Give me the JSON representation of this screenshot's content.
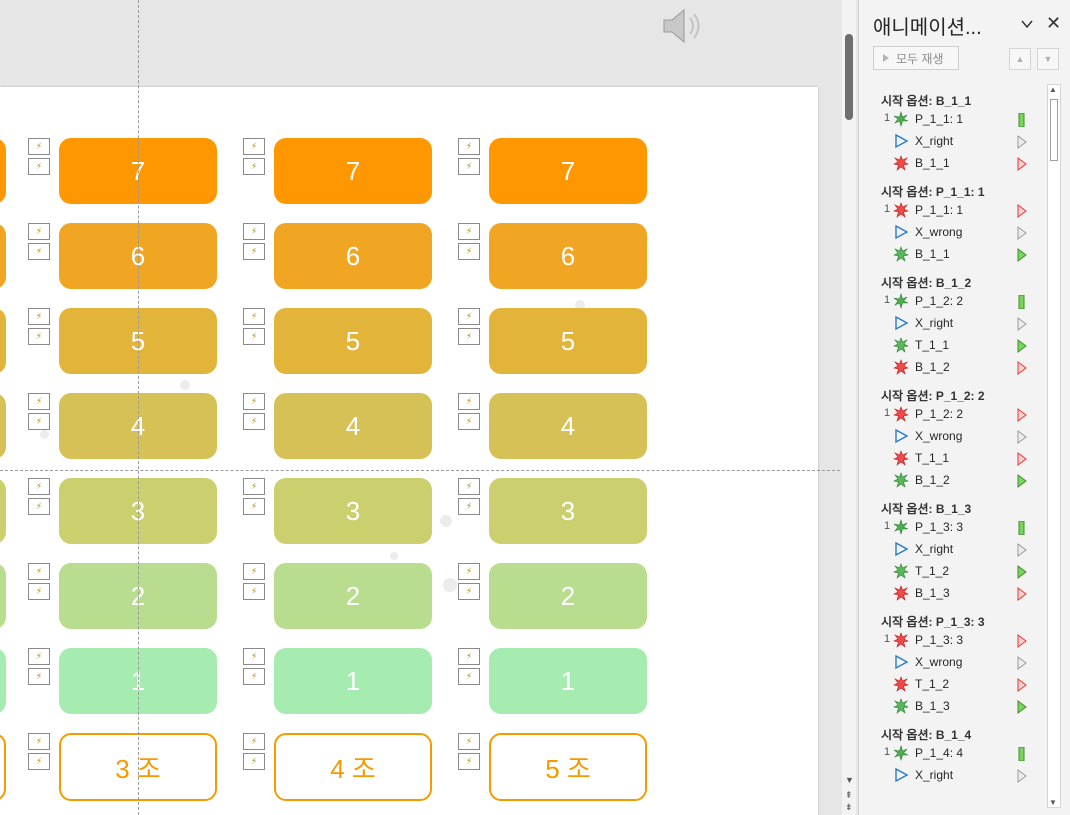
{
  "pane": {
    "title": "애니메이션...",
    "play_all_label": "모두 재생",
    "groups": [
      {
        "heading": "시작 옵션: B_1_1",
        "items": [
          {
            "num": "1",
            "label": "P_1_1: 1",
            "icon": "green-spark-icon",
            "timeline": "green-bar"
          },
          {
            "num": "",
            "label": "X_right",
            "icon": "play-triangle-icon",
            "timeline": "gray-triangle"
          },
          {
            "num": "",
            "label": "B_1_1",
            "icon": "red-burst-icon",
            "timeline": "red-triangle"
          }
        ]
      },
      {
        "heading": "시작 옵션: P_1_1: 1",
        "items": [
          {
            "num": "1",
            "label": "P_1_1: 1",
            "icon": "red-burst-icon",
            "timeline": "red-triangle"
          },
          {
            "num": "",
            "label": "X_wrong",
            "icon": "play-triangle-icon",
            "timeline": "gray-triangle"
          },
          {
            "num": "",
            "label": "B_1_1",
            "icon": "green-burst-icon",
            "timeline": "green-triangle"
          }
        ]
      },
      {
        "heading": "시작 옵션: B_1_2",
        "items": [
          {
            "num": "1",
            "label": "P_1_2: 2",
            "icon": "green-spark-icon",
            "timeline": "green-bar"
          },
          {
            "num": "",
            "label": "X_right",
            "icon": "play-triangle-icon",
            "timeline": "gray-triangle"
          },
          {
            "num": "",
            "label": "T_1_1",
            "icon": "green-burst-icon",
            "timeline": "green-triangle"
          },
          {
            "num": "",
            "label": "B_1_2",
            "icon": "red-burst-icon",
            "timeline": "red-triangle"
          }
        ]
      },
      {
        "heading": "시작 옵션: P_1_2: 2",
        "items": [
          {
            "num": "1",
            "label": "P_1_2: 2",
            "icon": "red-burst-icon",
            "timeline": "red-triangle"
          },
          {
            "num": "",
            "label": "X_wrong",
            "icon": "play-triangle-icon",
            "timeline": "gray-triangle"
          },
          {
            "num": "",
            "label": "T_1_1",
            "icon": "red-burst-icon",
            "timeline": "red-triangle"
          },
          {
            "num": "",
            "label": "B_1_2",
            "icon": "green-burst-icon",
            "timeline": "green-triangle"
          }
        ]
      },
      {
        "heading": "시작 옵션: B_1_3",
        "items": [
          {
            "num": "1",
            "label": "P_1_3: 3",
            "icon": "green-spark-icon",
            "timeline": "green-bar"
          },
          {
            "num": "",
            "label": "X_right",
            "icon": "play-triangle-icon",
            "timeline": "gray-triangle"
          },
          {
            "num": "",
            "label": "T_1_2",
            "icon": "green-burst-icon",
            "timeline": "green-triangle"
          },
          {
            "num": "",
            "label": "B_1_3",
            "icon": "red-burst-icon",
            "timeline": "red-triangle"
          }
        ]
      },
      {
        "heading": "시작 옵션: P_1_3: 3",
        "items": [
          {
            "num": "1",
            "label": "P_1_3: 3",
            "icon": "red-burst-icon",
            "timeline": "red-triangle"
          },
          {
            "num": "",
            "label": "X_wrong",
            "icon": "play-triangle-icon",
            "timeline": "gray-triangle"
          },
          {
            "num": "",
            "label": "T_1_2",
            "icon": "red-burst-icon",
            "timeline": "red-triangle"
          },
          {
            "num": "",
            "label": "B_1_3",
            "icon": "green-burst-icon",
            "timeline": "green-triangle"
          }
        ]
      },
      {
        "heading": "시작 옵션: B_1_4",
        "items": [
          {
            "num": "1",
            "label": "P_1_4: 4",
            "icon": "green-spark-icon",
            "timeline": "green-bar"
          },
          {
            "num": "",
            "label": "X_right",
            "icon": "play-triangle-icon",
            "timeline": "gray-triangle"
          }
        ]
      }
    ]
  },
  "slide": {
    "rows": [
      {
        "label": "7",
        "color": "#ff9800"
      },
      {
        "label": "6",
        "color": "#f0a623"
      },
      {
        "label": "5",
        "color": "#e3b43a"
      },
      {
        "label": "4",
        "color": "#d6c157"
      },
      {
        "label": "3",
        "color": "#cbcf6e"
      },
      {
        "label": "2",
        "color": "#b8dd8e"
      },
      {
        "label": "1",
        "color": "#a6ebaf"
      }
    ],
    "teams": [
      "3 조",
      "4 조",
      "5 조"
    ],
    "team_color": "#f59b00"
  }
}
